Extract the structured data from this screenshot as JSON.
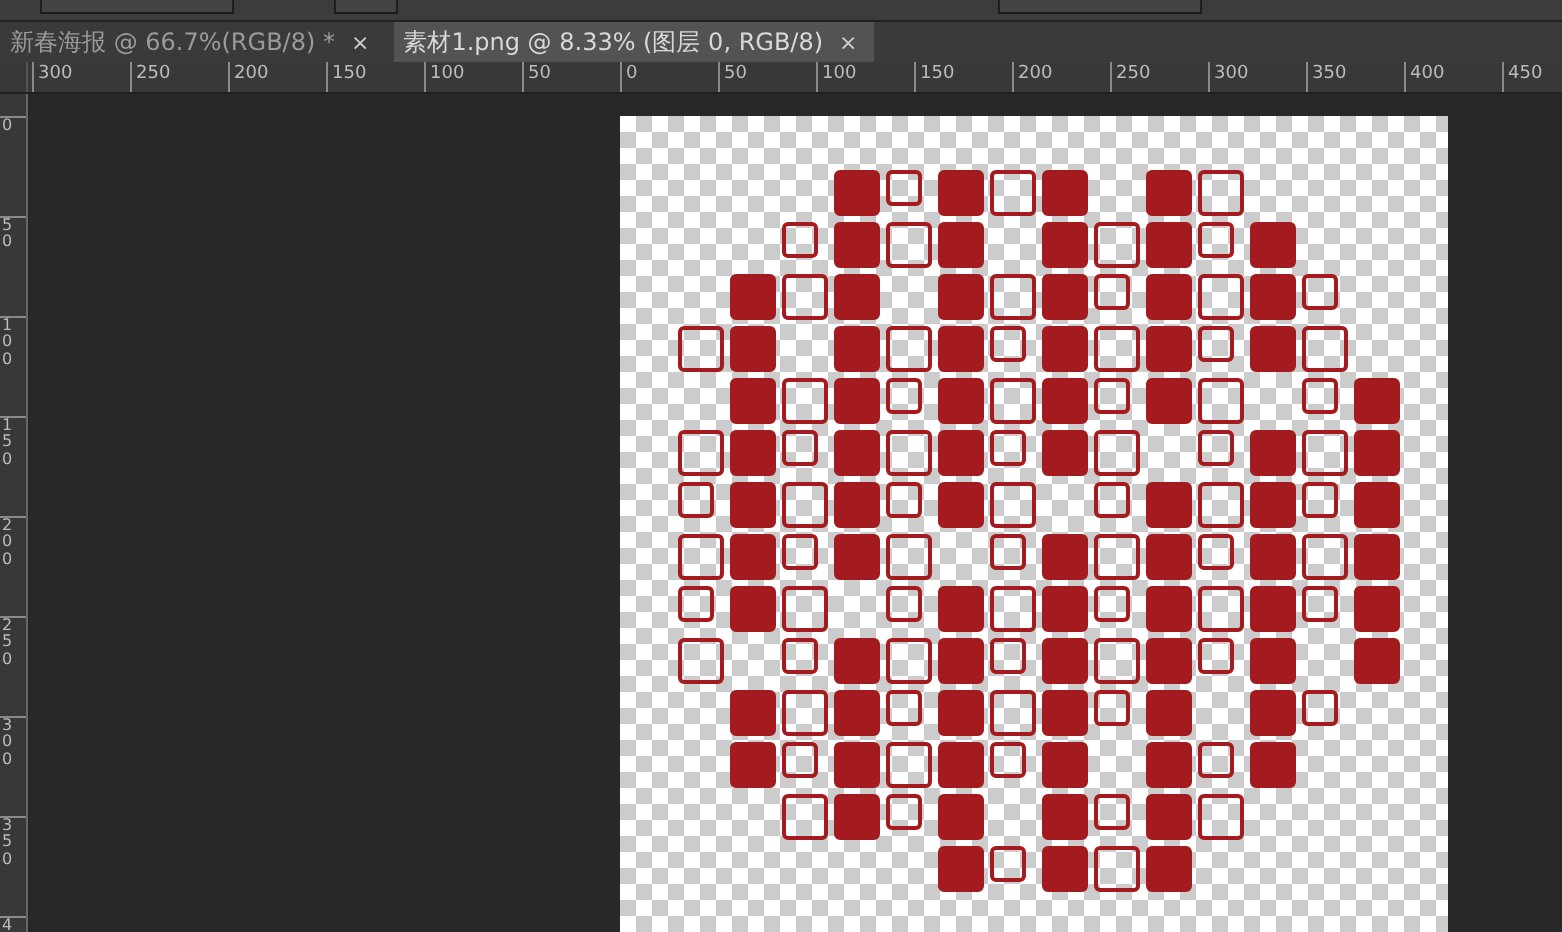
{
  "tabs": [
    {
      "label": "新春海报 @ 66.7%(RGB/8) *",
      "close": "×",
      "selected": false
    },
    {
      "label": "素材1.png @ 8.33% (图层 0, RGB/8)",
      "close": "×",
      "selected": true
    }
  ],
  "horizontal_ruler": {
    "labels": [
      "300",
      "250",
      "200",
      "150",
      "100",
      "50",
      "0",
      "50",
      "100",
      "150",
      "200",
      "250",
      "300",
      "350",
      "400",
      "450"
    ]
  },
  "vertical_ruler": {
    "labels": [
      "0",
      "50",
      "100",
      "150",
      "200",
      "250",
      "300",
      "350",
      "4"
    ]
  }
}
